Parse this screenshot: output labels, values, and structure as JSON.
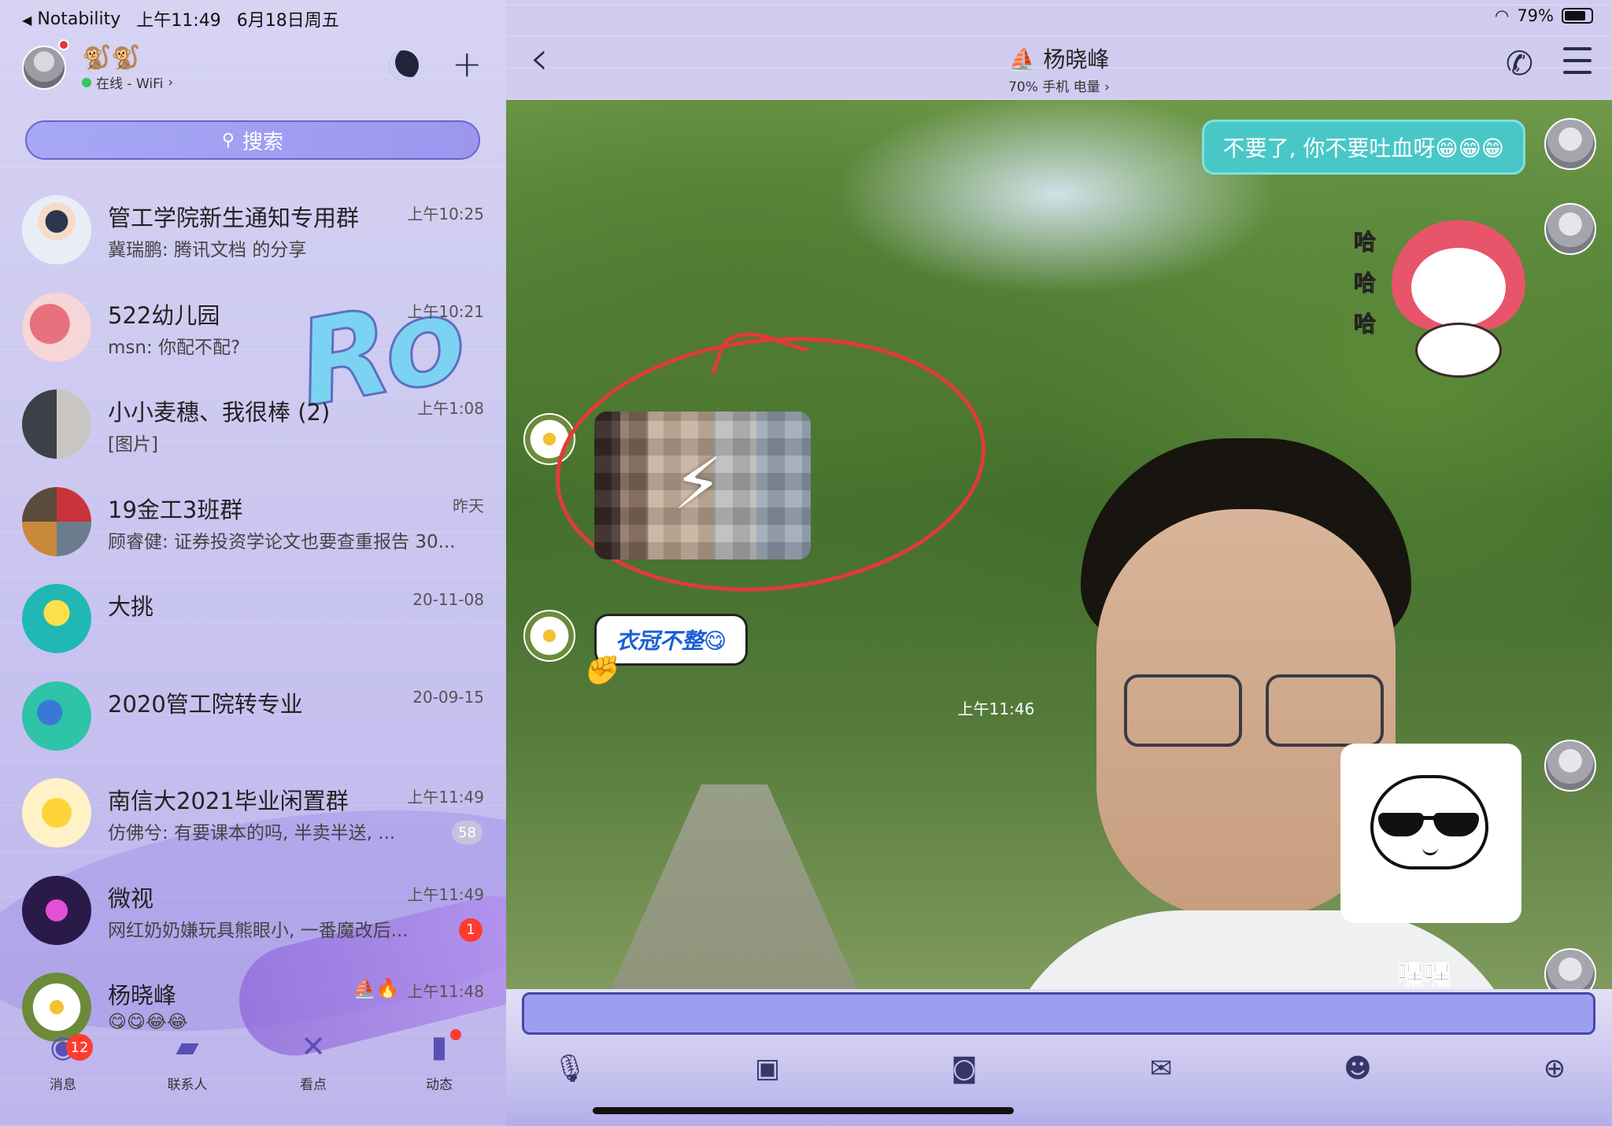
{
  "status_bar": {
    "back_app": "Notability",
    "time": "上午11:49",
    "date": "6月18日周五",
    "battery": "79%"
  },
  "me": {
    "status_text": "在线 - WiFi",
    "decor": "🐒🐒"
  },
  "search": {
    "icon": "search-icon",
    "placeholder": "搜索"
  },
  "chats": [
    {
      "name": "管工学院新生通知专用群",
      "preview": "冀瑞鹏: 腾讯文档 的分享",
      "time": "上午10:25",
      "badge": "",
      "avatar_color": "#e9eef6"
    },
    {
      "name": "522幼儿园",
      "preview": "msn: 你配不配?",
      "time": "上午10:21",
      "badge": "",
      "avatar_color": "#f0b8b8"
    },
    {
      "name": "小小麦穗、我很棒 (2)",
      "preview": "[图片]",
      "time": "上午1:08",
      "badge": "",
      "avatar_color": "#8d8f99"
    },
    {
      "name": "19金工3班群",
      "preview": "顾睿健: 证券投资学论文也要查重报告  30...",
      "time": "昨天",
      "badge": "",
      "avatar_color": "#7d6d5e"
    },
    {
      "name": "大挑",
      "preview": "",
      "time": "20-11-08",
      "badge": "",
      "avatar_color": "#1fb8b5"
    },
    {
      "name": "2020管工院转专业",
      "preview": "",
      "time": "20-09-15",
      "badge": "",
      "avatar_color": "#2ec4a8"
    },
    {
      "name": "南信大2021毕业闲置群",
      "preview": "仿佛兮: 有要课本的吗, 半卖半送, ...",
      "time": "上午11:49",
      "badge": "58",
      "badge_muted": true,
      "avatar_color": "#fff2c6"
    },
    {
      "name": "微视",
      "preview": "网红奶奶嫌玩具熊眼小, 一番魔改后...",
      "time": "上午11:49",
      "badge": "1",
      "avatar_color": "#2a1a4a"
    },
    {
      "name": "杨晓峰",
      "preview": "😋😋😂😂",
      "time": "上午11:48",
      "badge": "",
      "emoji_tail": "⛵🔥",
      "avatar_color": "#d8c49a"
    }
  ],
  "tabbar": {
    "messages": {
      "label": "消息",
      "badge": "12",
      "icon": "chat-icon"
    },
    "contacts": {
      "label": "联系人",
      "icon": "contacts-icon"
    },
    "watch": {
      "label": "看点",
      "icon": "watch-icon"
    },
    "feed": {
      "label": "动态",
      "icon": "feed-icon",
      "dot": true
    }
  },
  "conversation": {
    "peer_name": "⛵ 杨晓峰",
    "peer_sub": "70% 手机 电量 ›",
    "my_message": "不要了, 你不要吐血呀😁😁😁",
    "ha": [
      "哈",
      "哈",
      "哈"
    ],
    "text_sticker": "衣冠不整😋",
    "timestamp": "上午11:46",
    "heihei": "嘿嘿"
  },
  "toolbar_icons": [
    "mic-icon",
    "image-icon",
    "camera-icon",
    "red-packet-icon",
    "emoji-icon",
    "plus-icon"
  ],
  "colors": {
    "accent": "#6e63c9",
    "bubble_mine": "#49c7c7",
    "badge": "#ff3b30",
    "annotation_red": "#e23a3a"
  }
}
